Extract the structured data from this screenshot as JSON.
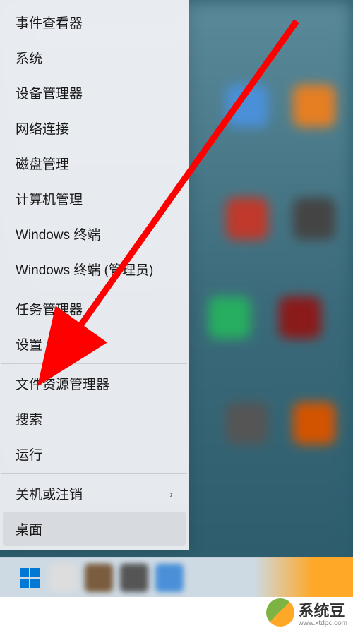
{
  "menu": {
    "groups": [
      [
        {
          "label": "事件查看器",
          "name": "menu-event-viewer",
          "submenu": false
        },
        {
          "label": "系统",
          "name": "menu-system",
          "submenu": false
        },
        {
          "label": "设备管理器",
          "name": "menu-device-manager",
          "submenu": false
        },
        {
          "label": "网络连接",
          "name": "menu-network-connections",
          "submenu": false
        },
        {
          "label": "磁盘管理",
          "name": "menu-disk-management",
          "submenu": false
        },
        {
          "label": "计算机管理",
          "name": "menu-computer-management",
          "submenu": false
        },
        {
          "label": "Windows 终端",
          "name": "menu-windows-terminal",
          "submenu": false
        },
        {
          "label": "Windows 终端 (管理员)",
          "name": "menu-windows-terminal-admin",
          "submenu": false
        }
      ],
      [
        {
          "label": "任务管理器",
          "name": "menu-task-manager",
          "submenu": false
        },
        {
          "label": "设置",
          "name": "menu-settings",
          "submenu": false
        }
      ],
      [
        {
          "label": "文件资源管理器",
          "name": "menu-file-explorer",
          "submenu": false
        },
        {
          "label": "搜索",
          "name": "menu-search",
          "submenu": false
        },
        {
          "label": "运行",
          "name": "menu-run",
          "submenu": false
        }
      ],
      [
        {
          "label": "关机或注销",
          "name": "menu-shutdown-signout",
          "submenu": true
        },
        {
          "label": "桌面",
          "name": "menu-desktop",
          "submenu": false,
          "hovered": true
        }
      ]
    ]
  },
  "annotation": {
    "target": "menu-settings",
    "arrow_color": "#ff0000"
  },
  "watermark": {
    "brand": "系统豆",
    "url": "www.xtdpc.com"
  },
  "colors": {
    "win_accent": "#0078d4"
  }
}
